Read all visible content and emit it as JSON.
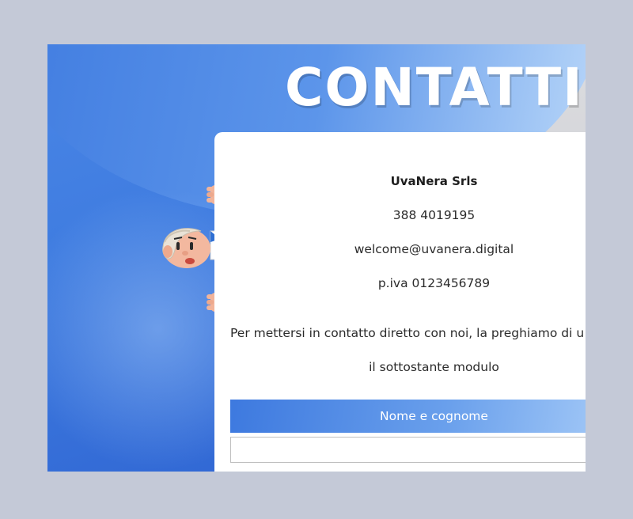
{
  "page": {
    "title": "CONTATTI"
  },
  "contact": {
    "company": "UvaNera Srls",
    "phone": "388 4019195",
    "email": "welcome@uvanera.digital",
    "vat": "p.iva 0123456789"
  },
  "intro": {
    "line1": "Per mettersi in contatto diretto con noi, la preghiamo di u",
    "line2": "il sottostante modulo"
  },
  "form": {
    "name_label": "Nome e cognome",
    "name_value": "",
    "name_placeholder": ""
  },
  "colors": {
    "outer_background": "#c4c9d7",
    "accent_blue": "#3d79df",
    "light_blue": "#a9cdf8",
    "text": "#2b2b2b"
  },
  "icons": {
    "mascot": "peeking-man-illustration"
  }
}
